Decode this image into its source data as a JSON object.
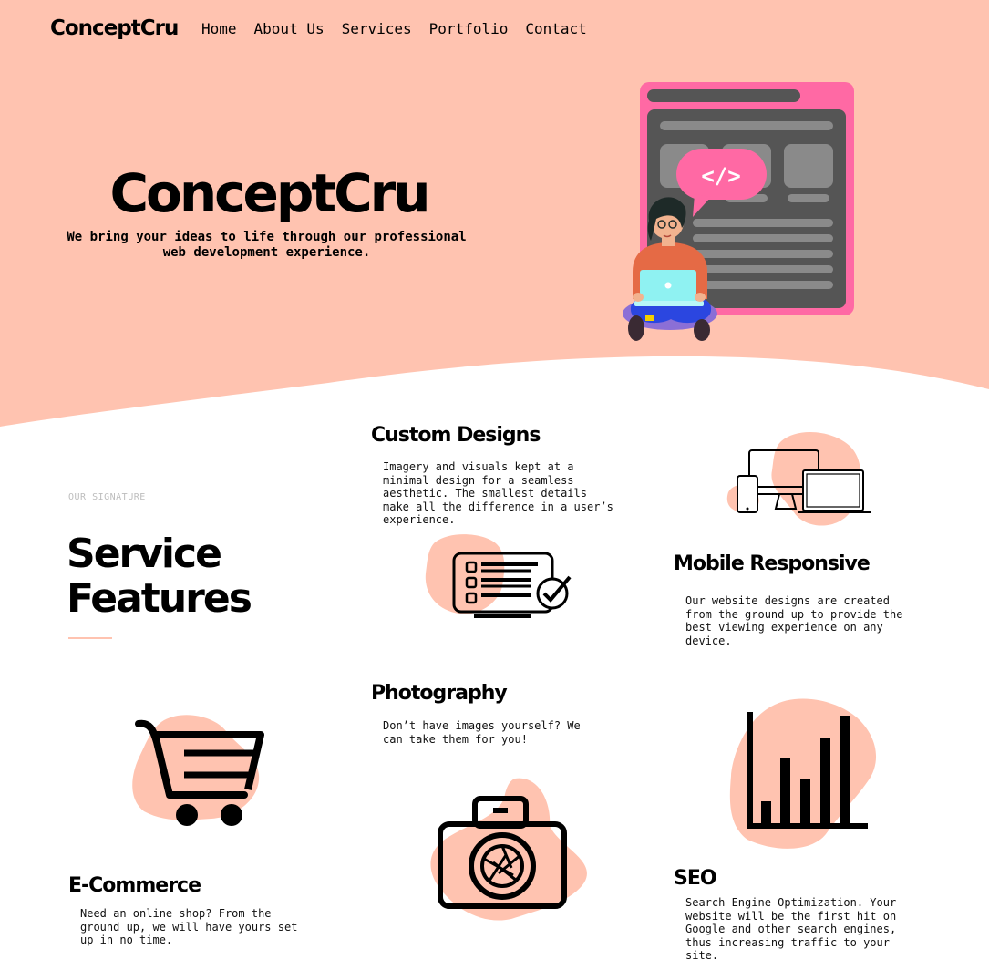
{
  "brand": "ConceptCru",
  "nav": [
    "Home",
    "About Us",
    "Services",
    "Portfolio",
    "Contact"
  ],
  "hero": {
    "title": "ConceptCru",
    "subtitle": "We bring your ideas to life through our professional web development experience.",
    "illustration_code": "</>"
  },
  "section": {
    "eyebrow": "OUR SIGNATURE",
    "title_line1": "Service",
    "title_line2": "Features"
  },
  "features": [
    {
      "title": "Custom Designs",
      "desc": "Imagery and visuals kept at a minimal design for a seamless aesthetic. The smallest details make all the difference in a user’s experience.",
      "icon": "checklist-monitor-icon"
    },
    {
      "title": "Mobile Responsive",
      "desc": "Our website designs are created from the ground up to provide the best viewing experience on any device.",
      "icon": "devices-icon"
    },
    {
      "title": "Photography",
      "desc": "Don’t have images yourself? We can take them for you!",
      "icon": "camera-icon"
    },
    {
      "title": "E-Commerce",
      "desc": "Need an online shop? From the ground up, we will have yours set up in no time.",
      "icon": "shopping-cart-icon"
    },
    {
      "title": "SEO",
      "desc": "Search Engine Optimization. Your website will be the first hit on Google and other search engines, thus increasing traffic to your site.",
      "icon": "bar-chart-icon"
    }
  ],
  "colors": {
    "hero_bg": "#ffc3b0",
    "accent_pink": "#ff69a4",
    "blob": "#ffc3b0",
    "screen": "#555555"
  }
}
